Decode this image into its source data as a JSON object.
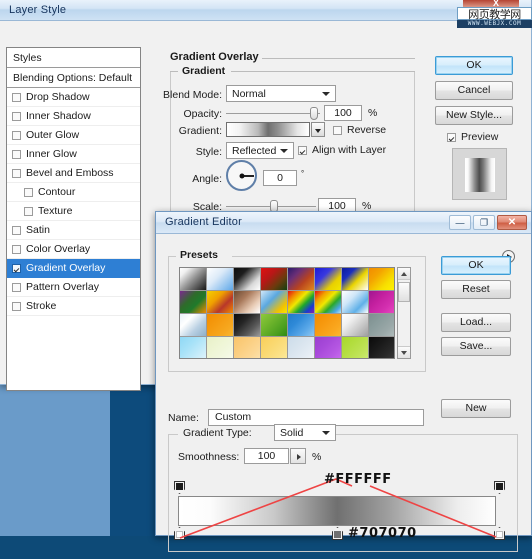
{
  "desktop": {
    "bg_dark": "#0e4c7b",
    "bg_light_panel": "#6a9bc9"
  },
  "watermark": {
    "cn_text": "网页教学网",
    "url_text": "WWW.WEBJX.COM",
    "x_glyph": "X"
  },
  "layer_style": {
    "title": "Layer Style",
    "styles_panel": {
      "header": "Styles",
      "blending_options": "Blending Options: Default",
      "items": [
        {
          "label": "Drop Shadow",
          "checked": false,
          "sub": false,
          "selected": false
        },
        {
          "label": "Inner Shadow",
          "checked": false,
          "sub": false,
          "selected": false
        },
        {
          "label": "Outer Glow",
          "checked": false,
          "sub": false,
          "selected": false
        },
        {
          "label": "Inner Glow",
          "checked": false,
          "sub": false,
          "selected": false
        },
        {
          "label": "Bevel and Emboss",
          "checked": false,
          "sub": false,
          "selected": false
        },
        {
          "label": "Contour",
          "checked": false,
          "sub": true,
          "selected": false
        },
        {
          "label": "Texture",
          "checked": false,
          "sub": true,
          "selected": false
        },
        {
          "label": "Satin",
          "checked": false,
          "sub": false,
          "selected": false
        },
        {
          "label": "Color Overlay",
          "checked": false,
          "sub": false,
          "selected": false
        },
        {
          "label": "Gradient Overlay",
          "checked": true,
          "sub": false,
          "selected": true
        },
        {
          "label": "Pattern Overlay",
          "checked": false,
          "sub": false,
          "selected": false
        },
        {
          "label": "Stroke",
          "checked": false,
          "sub": false,
          "selected": false
        }
      ]
    },
    "panel_title": "Gradient Overlay",
    "group_title": "Gradient",
    "fields": {
      "blend_mode_label": "Blend Mode:",
      "blend_mode_value": "Normal",
      "opacity_label": "Opacity:",
      "opacity_value": "100",
      "opacity_unit": "%",
      "gradient_label": "Gradient:",
      "reverse_label": "Reverse",
      "reverse_checked": false,
      "style_label": "Style:",
      "style_value": "Reflected",
      "align_label": "Align with Layer",
      "align_checked": true,
      "angle_label": "Angle:",
      "angle_value": "0",
      "angle_unit": "°",
      "scale_label": "Scale:",
      "scale_value": "100",
      "scale_unit": "%"
    },
    "buttons": {
      "ok": "OK",
      "cancel": "Cancel",
      "new_style": "New Style...",
      "preview_label": "Preview",
      "preview_checked": true
    }
  },
  "gradient_editor": {
    "title": "Gradient Editor",
    "window_buttons": {
      "minimize": "—",
      "maximize": "❐",
      "close": "✕"
    },
    "presets": {
      "label": "Presets",
      "menu_icon": "right-arrow-icon",
      "swatches": [
        "linear-gradient(135deg,#ffffff 0%,#f0f0f0 18%,#8f8f8f 52%,#171717 100%)",
        "linear-gradient(135deg,#ffffff 0%,#dceaf8 40%,#5fa8e8 100%)",
        "linear-gradient(135deg,#0d0d0d 0%,#1e1e1e 30%,#d9d9d9 72%,#ffffff 100%)",
        "linear-gradient(135deg,#e01111 0%,#b81717 35%,#6a3b0d 68%,#10400f 100%)",
        "linear-gradient(135deg,#2b1a6b 0%,#6b2f76 30%,#b8431f 62%,#e08a1c 100%)",
        "linear-gradient(135deg,#1a1ad6 0%,#3a3ae0 35%,#e8d000 70%,#f2e800 100%)",
        "linear-gradient(135deg,#0d1b9e 0%,#1b2fbe 28%,#ead400 58%,#ffffff 100%)",
        "linear-gradient(135deg,#f28c00 0%,#f4a300 30%,#f7e000 70%,#fff200 100%)",
        "linear-gradient(135deg,#7b2a8e 0%,#2f6b2a 38%,#1f7a2b 62%,#f28c00 100%)",
        "linear-gradient(135deg,#f5d000 0%,#f0a000 36%,#b8372a 66%,#f28c00 100%)",
        "linear-gradient(135deg,#6b4a32 0%,#a8785a 35%,#e8cbb4 70%,#ffffff 100%)",
        "linear-gradient(135deg,#cfe6f8 0%,#5ba8e0 40%,#f2c200 78%,#f7e400 100%)",
        "linear-gradient(135deg,#e01111 0%,#f28c00 22%,#f0e800 42%,#1fa82a 62%,#1a3ad0 82%,#8a1fb0 100%)",
        "linear-gradient(135deg,#e01111 0%,#f2a000 25%,#f0e800 45%,#2aa82a 65%,#4aa8e8 85%,#b8e8f5 100%)",
        "linear-gradient(135deg,#ffffff 0%,#cfe6f8 35%,#5fb0e8 70%,#ffffff 100%)",
        "linear-gradient(135deg,#a0168f 0%,#c21f9e 35%,#d42fb0 70%,#e84ac0 100%)",
        "linear-gradient(135deg,#e8f2fa 0%,#ffffff 30%,#b8cfe2 65%,#8fb0c8 100%)",
        "linear-gradient(135deg,#f28c00 0%,#f59b10 40%,#f7a820 75%,#f9b830 100%)",
        "linear-gradient(135deg,#0c0c0c 0%,#242424 35%,#5a5a5a 70%,#9a9a9a 100%)",
        "linear-gradient(135deg,#8ec83c 0%,#6cb32b 40%,#4a9e1f 75%,#2f8a14 100%)",
        "linear-gradient(135deg,#1f7ac8 0%,#2f8ad8 35%,#5aa8e8 70%,#8fc8f2 100%)",
        "linear-gradient(135deg,#f28c00 0%,#f79a10 40%,#faa820 75%,#fcb830 100%)",
        "linear-gradient(135deg,#ffffff 0%,#f0f0f0 30%,#c8c8c8 65%,#9e9e9e 100%)",
        "linear-gradient(135deg,#7d8f8f 0%,#8a9c9c 35%,#9aa8a8 70%,#b0bcbc 100%)",
        "linear-gradient(135deg,#8fd8f5 0%,#a8e2f8 40%,#c8ecfa 75%,#e0f4fc 100%)",
        "linear-gradient(135deg,#e8f0c8 0%,#eef5d4 40%,#f2f8e0 75%,#f8fbec 100%)",
        "linear-gradient(135deg,#f9c46a 0%,#fbce80 40%,#fcd896 75%,#fde2ac 100%)",
        "linear-gradient(135deg,#f9cf5a 0%,#fad870 40%,#fbe186 75%,#fcea9c 100%)",
        "linear-gradient(135deg,#ccdcea 0%,#d8e4ee 40%,#e4ecf4 75%,#f0f4f8 100%)",
        "linear-gradient(135deg,#9a3fd0 0%,#a84ada 40%,#b85ae4 75%,#c86aee 100%)",
        "linear-gradient(135deg,#a8d82a 0%,#b4de42 40%,#c0e45a 75%,#cceb72 100%)",
        "linear-gradient(135deg,#0a0a0a 0%,#1a1a1a 40%,#2a2a2a 75%,#3a3a3a 100%)"
      ]
    },
    "buttons": {
      "ok": "OK",
      "reset": "Reset",
      "load": "Load...",
      "save": "Save...",
      "new": "New"
    },
    "name_label": "Name:",
    "name_value": "Custom",
    "gradient_type_label": "Gradient Type:",
    "gradient_type_value": "Solid",
    "smoothness_label": "Smoothness:",
    "smoothness_value": "100",
    "smoothness_unit": "%",
    "annotations": {
      "white_hex": "#FFFFFF",
      "gray_hex": "#707070",
      "line_color": "#ee4444"
    },
    "stops": {
      "opacity_left": "opacity-stop-left",
      "opacity_right": "opacity-stop-right",
      "color_left": "color-stop-left",
      "color_mid": "color-stop-mid",
      "color_right": "color-stop-right"
    }
  }
}
